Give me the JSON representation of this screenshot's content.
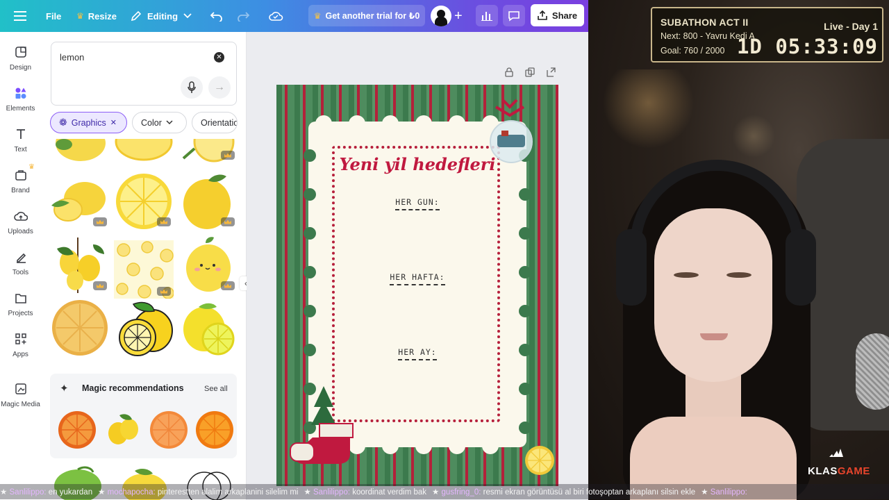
{
  "topbar": {
    "file": "File",
    "resize": "Resize",
    "editing": "Editing",
    "trial": "Get another trial for ₺0",
    "share": "Share"
  },
  "rail": [
    {
      "label": "Design",
      "icon": "design-icon"
    },
    {
      "label": "Elements",
      "icon": "elements-icon"
    },
    {
      "label": "Text",
      "icon": "text-icon"
    },
    {
      "label": "Brand",
      "icon": "brand-icon"
    },
    {
      "label": "Uploads",
      "icon": "uploads-icon"
    },
    {
      "label": "Tools",
      "icon": "tools-icon"
    },
    {
      "label": "Projects",
      "icon": "projects-icon"
    },
    {
      "label": "Apps",
      "icon": "apps-icon"
    },
    {
      "label": "Magic Media",
      "icon": "magic-media-icon"
    }
  ],
  "panel": {
    "search_value": "lemon",
    "chips": {
      "graphics": "Graphics",
      "color": "Color",
      "orientation": "Orientation"
    },
    "magic_title": "Magic recommendations",
    "see_all": "See all"
  },
  "card": {
    "title": "Yeni yil hedefleri",
    "label1": "HER GUN:",
    "label2": "HER HAFTA:",
    "label3": "HER AY:"
  },
  "overlay": {
    "title": "SUBATHON ACT II",
    "live": "Live - Day 1",
    "next": "Next: 800 - Yavru Kedi A",
    "goal": "Goal: 760 / 2000",
    "timer": "1D 05:33:09"
  },
  "brand": {
    "part1": "KLAS",
    "part2": "GAME"
  },
  "ticker": [
    {
      "name": "Sanlilippo:",
      "msg": "en yukardan"
    },
    {
      "name": "mochapocha:",
      "msg": "pinterestten alalim arkaplanini silelim mi"
    },
    {
      "name": "Sanlilippo:",
      "msg": "koordinat verdim bak"
    },
    {
      "name": "gusfring_0:",
      "msg": "resmi ekran görüntüsü al biri fotoşoptan arkaplanı silsin ekle"
    },
    {
      "name": "Sanlilippo:",
      "msg": ""
    }
  ],
  "colors": {
    "canva_gradient_start": "#21c0c8",
    "canva_gradient_end": "#7a3fe0",
    "card_red": "#c0193f",
    "card_green": "#3c7a4d",
    "card_cream": "#fbf8ec"
  }
}
